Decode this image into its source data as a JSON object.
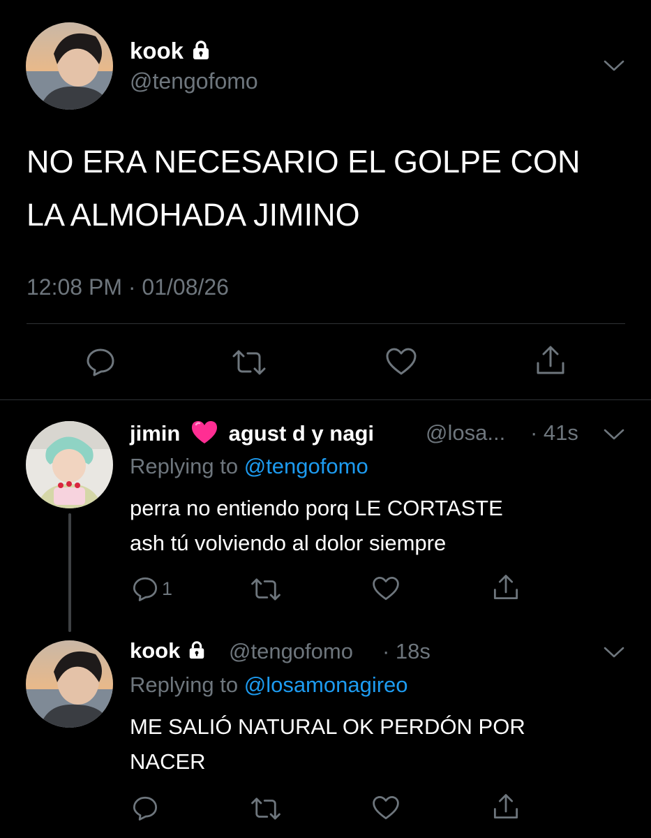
{
  "main_tweet": {
    "display_name": "kook",
    "handle": "@tengofomo",
    "text_line1": "NO ERA NECESARIO EL GOLPE CON",
    "text_line2": "LA ALMOHADA JIMINO",
    "timestamp": "12:08 PM · 01/08/26"
  },
  "reply1": {
    "display_name_part1": "jimin",
    "display_name_emoji": "💗",
    "display_name_part2": "agust d y nagi",
    "handle": "@losa...",
    "time": "· 41s",
    "replying_label": "Replying to",
    "replying_to": "@tengofomo",
    "text_line1": "perra no entiendo porq LE CORTASTE",
    "text_line2": "ash tú volviendo al dolor siempre",
    "reply_count": "1"
  },
  "reply2": {
    "display_name": "kook",
    "handle": "@tengofomo",
    "time": "· 18s",
    "replying_label": "Replying to",
    "replying_to": "@losamonagireo",
    "text_line1": "ME SALIÓ NATURAL OK PERDÓN POR",
    "text_line2": "NACER"
  },
  "colors": {
    "background": "#000000",
    "muted": "#6e767d",
    "link": "#1d9bf0",
    "heart": "#ff2e93"
  },
  "icons": [
    "lock-icon",
    "chevron-down-icon",
    "reply-icon",
    "retweet-icon",
    "like-icon",
    "share-icon"
  ]
}
